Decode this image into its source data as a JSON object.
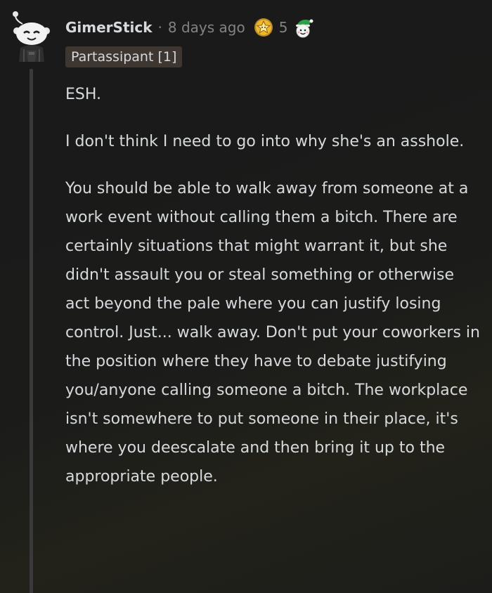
{
  "comment": {
    "username": "GimerStick",
    "separator": "·",
    "timestamp": "8 days ago",
    "award_count": "5",
    "flair": "Partassipant [1]",
    "paragraphs": [
      "ESH.",
      "I don't think I need to go into why she's an asshole.",
      "You should be able to walk away from someone at a work event without calling them a bitch. There are certainly situations that might warrant it, but she didn't assault you or steal something or otherwise act beyond the pale where you can justify losing control. Just... walk away. Don't put your coworkers in the position where they have to debate justifying you/anyone calling someone a bitch. The workplace isn't somewhere to put someone in their place, it's where you deescalate and then bring it up to the appropriate people."
    ]
  },
  "icons": {
    "avatar": "snoo-avatar-icon",
    "award_1": "star-award-icon",
    "award_2": "elf-award-icon"
  },
  "colors": {
    "background": "#1a1a1b",
    "text": "#d7dadc",
    "meta": "#818384",
    "flair_bg": "#3e3631",
    "thread_line": "#3a3a3a"
  }
}
